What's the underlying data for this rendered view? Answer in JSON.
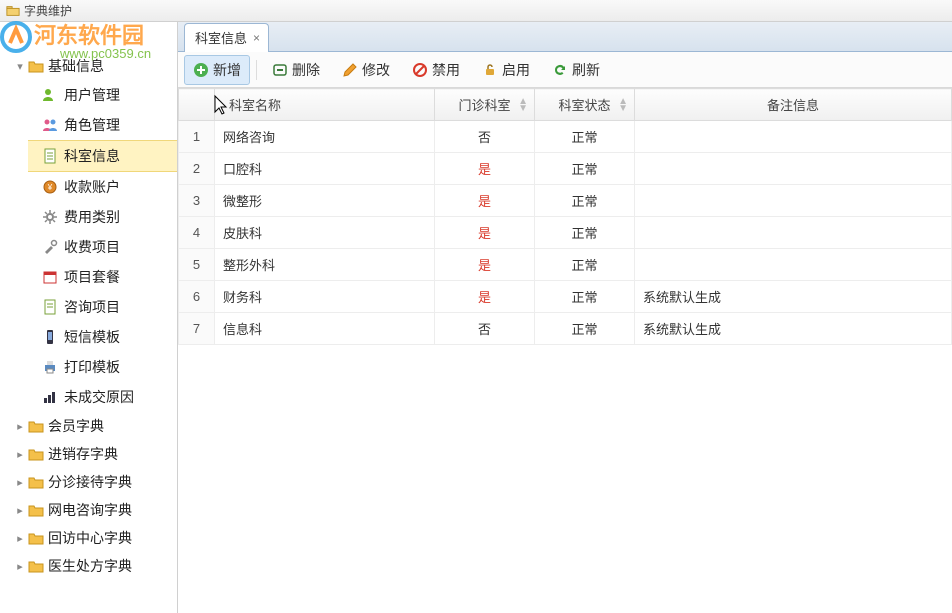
{
  "window": {
    "title": "字典维护"
  },
  "watermark": {
    "text": "河东软件园",
    "url": "www.pc0359.cn"
  },
  "sidebar": {
    "expanded_group": "基础信息",
    "groups": [
      {
        "label": "基础信息",
        "open": true,
        "children": [
          {
            "label": "用户管理",
            "icon": "users-icon"
          },
          {
            "label": "角色管理",
            "icon": "roles-icon"
          },
          {
            "label": "科室信息",
            "icon": "doc-icon",
            "selected": true
          },
          {
            "label": "收款账户",
            "icon": "coin-icon"
          },
          {
            "label": "费用类别",
            "icon": "gear-icon"
          },
          {
            "label": "收费项目",
            "icon": "tools-icon"
          },
          {
            "label": "项目套餐",
            "icon": "calendar-icon"
          },
          {
            "label": "咨询项目",
            "icon": "page-icon"
          },
          {
            "label": "短信模板",
            "icon": "phone-icon"
          },
          {
            "label": "打印模板",
            "icon": "printer-icon"
          },
          {
            "label": "未成交原因",
            "icon": "chart-icon"
          }
        ]
      },
      {
        "label": "会员字典",
        "open": false
      },
      {
        "label": "进销存字典",
        "open": false
      },
      {
        "label": "分诊接待字典",
        "open": false
      },
      {
        "label": "网电咨询字典",
        "open": false
      },
      {
        "label": "回访中心字典",
        "open": false
      },
      {
        "label": "医生处方字典",
        "open": false
      }
    ]
  },
  "tab": {
    "label": "科室信息"
  },
  "toolbar": {
    "add": "新增",
    "delete": "删除",
    "edit": "修改",
    "disable": "禁用",
    "enable": "启用",
    "refresh": "刷新"
  },
  "table": {
    "columns": {
      "index": "",
      "name": "科室名称",
      "outpatient": "门诊科室",
      "status": "科室状态",
      "remark": "备注信息"
    },
    "rows": [
      {
        "idx": "1",
        "name": "网络咨询",
        "outpatient": "否",
        "out_red": false,
        "status": "正常",
        "remark": ""
      },
      {
        "idx": "2",
        "name": "口腔科",
        "outpatient": "是",
        "out_red": true,
        "status": "正常",
        "remark": ""
      },
      {
        "idx": "3",
        "name": "微整形",
        "outpatient": "是",
        "out_red": true,
        "status": "正常",
        "remark": ""
      },
      {
        "idx": "4",
        "name": "皮肤科",
        "outpatient": "是",
        "out_red": true,
        "status": "正常",
        "remark": ""
      },
      {
        "idx": "5",
        "name": "整形外科",
        "outpatient": "是",
        "out_red": true,
        "status": "正常",
        "remark": ""
      },
      {
        "idx": "6",
        "name": "财务科",
        "outpatient": "是",
        "out_red": true,
        "status": "正常",
        "remark": "系统默认生成"
      },
      {
        "idx": "7",
        "name": "信息科",
        "outpatient": "否",
        "out_red": false,
        "status": "正常",
        "remark": "系统默认生成"
      }
    ]
  }
}
